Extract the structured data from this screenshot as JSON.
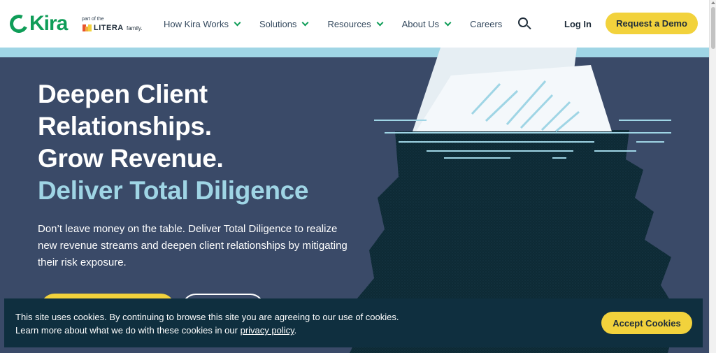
{
  "header": {
    "logo_text": "Kira",
    "parent_prefix": "part of the",
    "parent_brand": "LITERA",
    "parent_suffix": "family.",
    "nav": [
      {
        "label": "How Kira Works"
      },
      {
        "label": "Solutions"
      },
      {
        "label": "Resources"
      },
      {
        "label": "About Us"
      },
      {
        "label": "Careers"
      }
    ],
    "login_label": "Log In",
    "demo_label": "Request a Demo"
  },
  "hero": {
    "title_lines": [
      "Deepen Client",
      "Relationships.",
      "Grow Revenue."
    ],
    "title_accent": "Deliver Total Diligence",
    "description": "Don’t leave money on the table. Deliver Total Diligence to realize new revenue streams and deepen client relationships by mitigating their risk exposure."
  },
  "cookie": {
    "text_1": "This site uses cookies. By continuing to browse this site you are agreeing to our use of cookies.",
    "text_2": "Learn more about what we do with these cookies in our",
    "link_label": "privacy policy",
    "text_end": ".",
    "accept_label": "Accept Cookies"
  },
  "colors": {
    "brand_green": "#0f9d58",
    "accent_yellow": "#f2d23c",
    "hero_bg": "#3a4a68",
    "hero_accent": "#9fd5e5",
    "cookie_bg": "#0f2f3f"
  }
}
